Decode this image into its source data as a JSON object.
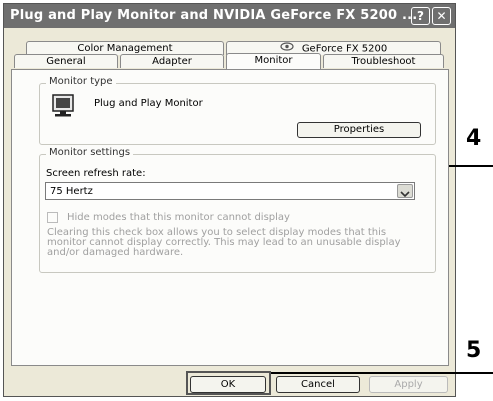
{
  "window": {
    "title": "Plug and Play Monitor and NVIDIA GeForce FX 5200 ...",
    "help_btn": "?",
    "close_btn": "✕"
  },
  "tabs": {
    "row1": [
      "Color Management",
      "GeForce FX 5200"
    ],
    "row2": [
      "General",
      "Adapter",
      "Monitor",
      "Troubleshoot"
    ],
    "active": "Monitor"
  },
  "monitor_type": {
    "legend": "Monitor type",
    "name": "Plug and Play Monitor",
    "properties_button": "Properties"
  },
  "monitor_settings": {
    "legend": "Monitor settings",
    "refresh_label": "Screen refresh rate:",
    "refresh_value": "75 Hertz",
    "hide_modes_label": "Hide modes that this monitor cannot display",
    "hide_modes_checked": false,
    "description": [
      "Clearing this check box allows you to select display modes that this",
      "monitor cannot display correctly. This may lead to an unusable display",
      "and/or damaged hardware."
    ]
  },
  "buttons": {
    "ok": "OK",
    "cancel": "Cancel",
    "apply": "Apply"
  },
  "callouts": [
    "4",
    "5"
  ]
}
